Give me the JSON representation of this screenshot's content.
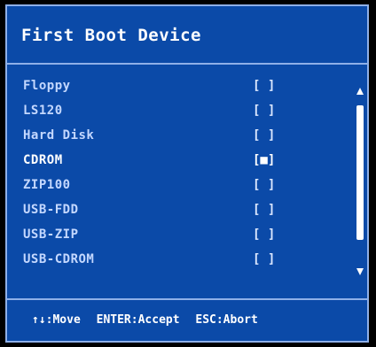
{
  "dialog": {
    "title": "First Boot Device",
    "items": [
      {
        "label": "Floppy",
        "check": "[ ]"
      },
      {
        "label": "LS120",
        "check": "[ ]"
      },
      {
        "label": "Hard Disk",
        "check": "[ ]"
      },
      {
        "label": "CDROM",
        "check": "[■]"
      },
      {
        "label": "ZIP100",
        "check": "[ ]"
      },
      {
        "label": "USB-FDD",
        "check": "[ ]"
      },
      {
        "label": "USB-ZIP",
        "check": "[ ]"
      },
      {
        "label": "USB-CDROM",
        "check": "[ ]"
      }
    ],
    "selected_index": 3,
    "help": {
      "move": "↑↓:Move",
      "accept": "ENTER:Accept",
      "abort": "ESC:Abort"
    }
  },
  "colors": {
    "background": "#0b4aa8",
    "border": "#8fb0e8",
    "text": "#c4d8ff"
  },
  "icons": {
    "scroll_up": "triangle-up-icon",
    "scroll_down": "triangle-down-icon"
  }
}
